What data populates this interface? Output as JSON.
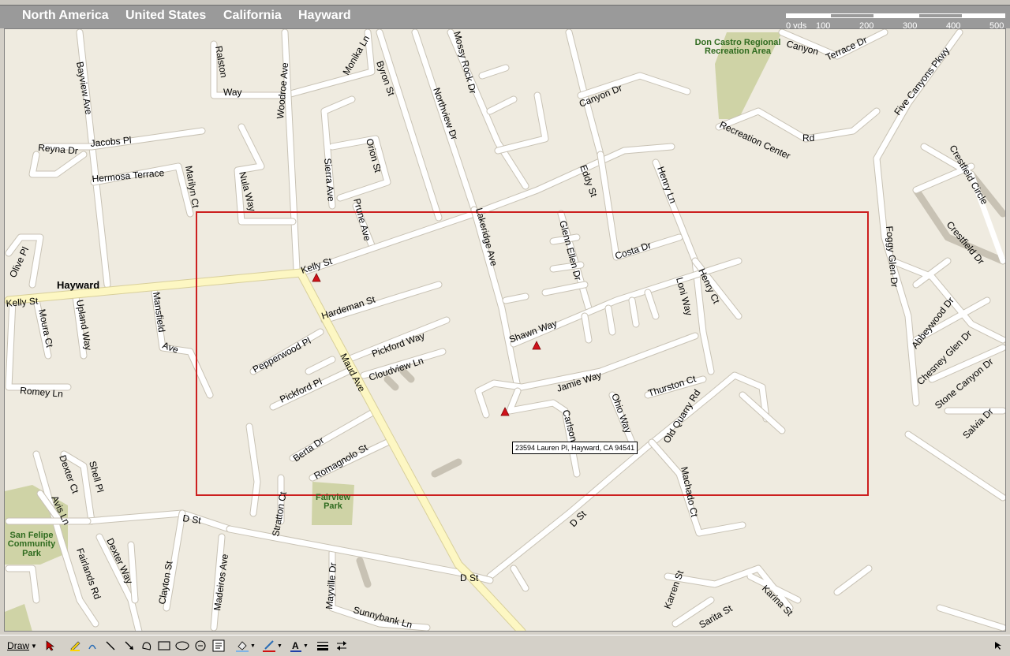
{
  "breadcrumb": [
    "North America",
    "United States",
    "California",
    "Hayward"
  ],
  "scale": {
    "labels": [
      "0 yds",
      "100",
      "200",
      "300",
      "400",
      "500"
    ]
  },
  "map": {
    "city_label": "Hayward",
    "parks": [
      "Don Castro Regional",
      "Recreation Area",
      "Fairview",
      "Park",
      "San Felipe",
      "Community",
      "Park"
    ],
    "streets": [
      "Ralston",
      "Way",
      "Woodroe Ave",
      "Monika Ln",
      "Byron St",
      "Mossy Rock Dr",
      "Northview Dr",
      "Canyon Dr",
      "Canyon",
      "Terrace Dr",
      "Five Canyons Pkwy",
      "Bayview Ave",
      "Jacobs Pl",
      "Reyna Dr",
      "Hermosa Terrace",
      "Marilyn Ct",
      "Nula Way",
      "Sierra Ave",
      "Orion St",
      "Prune Ave",
      "Eddy St",
      "Henry Ln",
      "Recreation Center",
      "Rd",
      "Crestfield Circle",
      "Crestfield Dr",
      "Foggy Glen Dr",
      "Abbeywood Dr",
      "Chesney Glen Dr",
      "Stone Canyon Dr",
      "Salvia Dr",
      "Lakeridge Ave",
      "Glenn Ellen Dr",
      "Costa Dr",
      "Loni Way",
      "Henry Ct",
      "Olive Pl",
      "Kelly St",
      "Kelly St",
      "Mansfield",
      "Ave",
      "Upland Way",
      "Moura Ct",
      "Romey Ln",
      "Hardeman St",
      "Pepperwood Pl",
      "Maud Ave",
      "Pickford Way",
      "Pickford Pl",
      "Cloudview Ln",
      "Shawn Way",
      "Jamie Way",
      "Thurston Ct",
      "Ohio Way",
      "Old Quarry Rd",
      "Carlson Ct",
      "Berta Dr",
      "Romagnolo St",
      "Stratton Ct",
      "Dexter Ct",
      "Shell Pl",
      "Avis Ln",
      "Fairlands Rd",
      "Dexter Way",
      "Clayton St",
      "Madeiros Ave",
      "Mayville Dr",
      "Sunnybank Ln",
      "D St",
      "D St",
      "D St",
      "Machado Ct",
      "Karren St",
      "Sarita St",
      "Karina St"
    ],
    "tooltip": "23594 Lauren Pl, Hayward, CA 94541",
    "colors": {
      "map_bg": "#efebe0",
      "road": "#ffffff",
      "major_road": "#fdf7c3",
      "park": "#cfd3a6",
      "route_box": "#cc1f1f",
      "marker": "#d0121b"
    }
  },
  "toolbar": {
    "draw_label": "Draw",
    "icons": [
      "pointer-icon",
      "autoshape-icon",
      "line-icon",
      "arrow-icon",
      "rectangle-icon",
      "oval-icon",
      "textbox-icon",
      "fill-color-icon",
      "line-color-icon",
      "font-color-icon",
      "line-style-icon",
      "arrow-style-icon"
    ]
  }
}
